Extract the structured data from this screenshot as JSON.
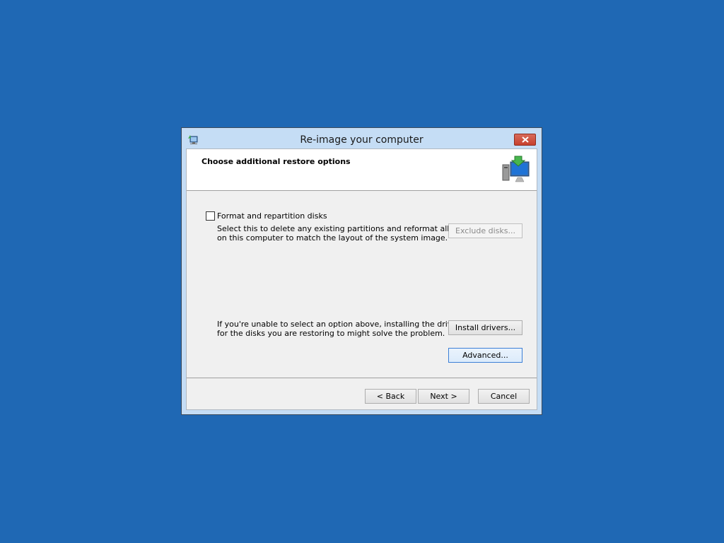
{
  "window": {
    "title": "Re-image your computer"
  },
  "header": {
    "title": "Choose additional restore options"
  },
  "format_option": {
    "label": "Format and repartition disks",
    "checked": false,
    "desc_line1": "Select this to delete any existing partitions and reformat all disks",
    "desc_line2": "on this computer to match the layout of the system image."
  },
  "exclude_disks": {
    "label": "Exclude disks..."
  },
  "drivers_info": {
    "line1": "If you're unable to select an option above, installing the drivers",
    "line2": "for the disks you are restoring to might solve the problem."
  },
  "buttons": {
    "install_drivers": "Install drivers...",
    "advanced": "Advanced...",
    "back": "< Back",
    "next": "Next >",
    "cancel": "Cancel"
  },
  "icons": {
    "title": "backup-restore-icon",
    "header": "computer-restore-icon",
    "close": "close-icon"
  },
  "colors": {
    "desktop": "#1f68b4",
    "close_button": "#c7402d"
  }
}
